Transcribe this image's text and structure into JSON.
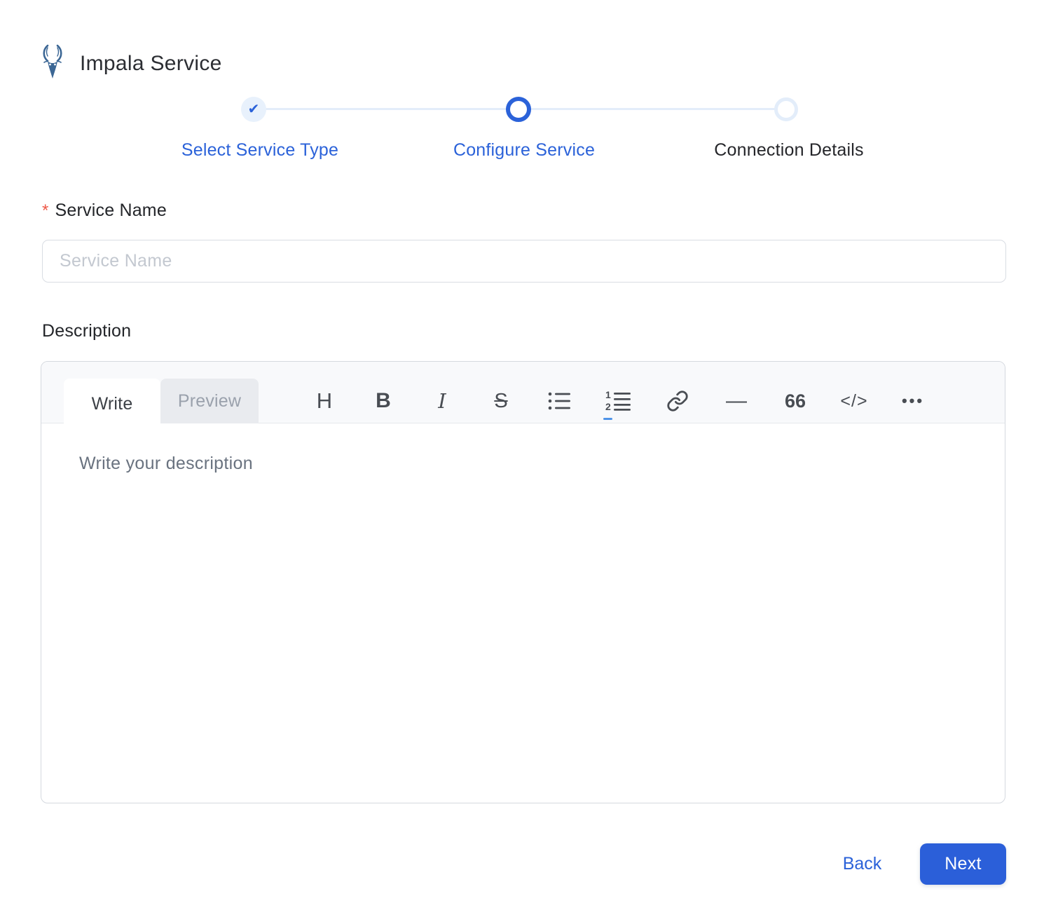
{
  "header": {
    "title": "Impala Service",
    "logo": "impala-logo"
  },
  "stepper": {
    "steps": [
      {
        "label": "Select Service Type",
        "state": "completed"
      },
      {
        "label": "Configure Service",
        "state": "active"
      },
      {
        "label": "Connection Details",
        "state": "upcoming"
      }
    ]
  },
  "form": {
    "service_name": {
      "required_mark": "*",
      "label": "Service Name",
      "placeholder": "Service Name",
      "value": ""
    },
    "description": {
      "label": "Description",
      "editor": {
        "tabs": [
          {
            "label": "Write",
            "active": true
          },
          {
            "label": "Preview",
            "active": false
          }
        ],
        "toolbar_glyphs": {
          "heading": "H",
          "bold": "B",
          "italic": "I",
          "strikethrough": "S",
          "horizontal_rule": "—",
          "quote": "66",
          "code": "</>",
          "more": "•••"
        },
        "toolbar_icons": [
          "heading-icon",
          "bold-icon",
          "italic-icon",
          "strikethrough-icon",
          "bulleted-list-icon",
          "numbered-list-icon",
          "link-icon",
          "horizontal-rule-icon",
          "quote-icon",
          "code-icon",
          "more-icon"
        ],
        "placeholder": "Write your description",
        "value": ""
      }
    }
  },
  "footer": {
    "back_label": "Back",
    "next_label": "Next"
  },
  "colors": {
    "accent_blue": "#2b62d9",
    "button_blue": "#2b5fd9",
    "completed_step_bg": "#e8f1fc",
    "upcoming_step_ring": "#e3edfa",
    "required_red": "#ee5948",
    "input_border": "#d9dde3",
    "editor_header_bg": "#f8f9fb",
    "placeholder_gray": "#c3c8d0"
  }
}
